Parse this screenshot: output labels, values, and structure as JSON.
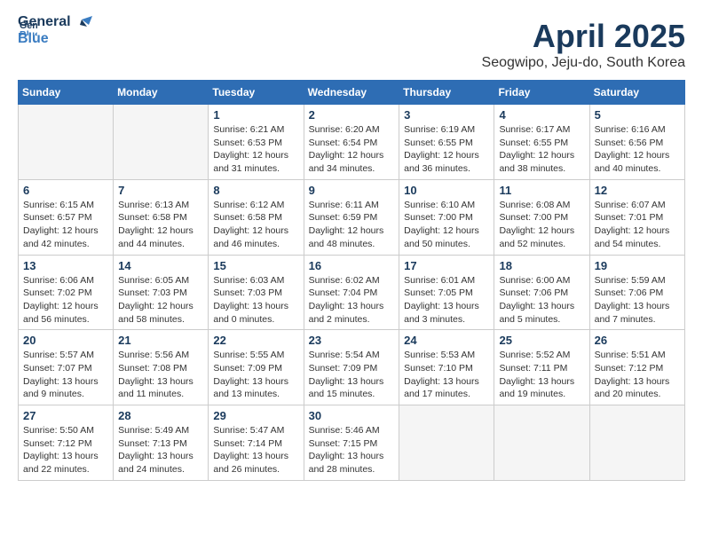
{
  "header": {
    "logo_line1": "General",
    "logo_line2": "Blue",
    "month": "April 2025",
    "location": "Seogwipo, Jeju-do, South Korea"
  },
  "weekdays": [
    "Sunday",
    "Monday",
    "Tuesday",
    "Wednesday",
    "Thursday",
    "Friday",
    "Saturday"
  ],
  "weeks": [
    [
      {
        "day": "",
        "info": ""
      },
      {
        "day": "",
        "info": ""
      },
      {
        "day": "1",
        "info": "Sunrise: 6:21 AM\nSunset: 6:53 PM\nDaylight: 12 hours\nand 31 minutes."
      },
      {
        "day": "2",
        "info": "Sunrise: 6:20 AM\nSunset: 6:54 PM\nDaylight: 12 hours\nand 34 minutes."
      },
      {
        "day": "3",
        "info": "Sunrise: 6:19 AM\nSunset: 6:55 PM\nDaylight: 12 hours\nand 36 minutes."
      },
      {
        "day": "4",
        "info": "Sunrise: 6:17 AM\nSunset: 6:55 PM\nDaylight: 12 hours\nand 38 minutes."
      },
      {
        "day": "5",
        "info": "Sunrise: 6:16 AM\nSunset: 6:56 PM\nDaylight: 12 hours\nand 40 minutes."
      }
    ],
    [
      {
        "day": "6",
        "info": "Sunrise: 6:15 AM\nSunset: 6:57 PM\nDaylight: 12 hours\nand 42 minutes."
      },
      {
        "day": "7",
        "info": "Sunrise: 6:13 AM\nSunset: 6:58 PM\nDaylight: 12 hours\nand 44 minutes."
      },
      {
        "day": "8",
        "info": "Sunrise: 6:12 AM\nSunset: 6:58 PM\nDaylight: 12 hours\nand 46 minutes."
      },
      {
        "day": "9",
        "info": "Sunrise: 6:11 AM\nSunset: 6:59 PM\nDaylight: 12 hours\nand 48 minutes."
      },
      {
        "day": "10",
        "info": "Sunrise: 6:10 AM\nSunset: 7:00 PM\nDaylight: 12 hours\nand 50 minutes."
      },
      {
        "day": "11",
        "info": "Sunrise: 6:08 AM\nSunset: 7:00 PM\nDaylight: 12 hours\nand 52 minutes."
      },
      {
        "day": "12",
        "info": "Sunrise: 6:07 AM\nSunset: 7:01 PM\nDaylight: 12 hours\nand 54 minutes."
      }
    ],
    [
      {
        "day": "13",
        "info": "Sunrise: 6:06 AM\nSunset: 7:02 PM\nDaylight: 12 hours\nand 56 minutes."
      },
      {
        "day": "14",
        "info": "Sunrise: 6:05 AM\nSunset: 7:03 PM\nDaylight: 12 hours\nand 58 minutes."
      },
      {
        "day": "15",
        "info": "Sunrise: 6:03 AM\nSunset: 7:03 PM\nDaylight: 13 hours\nand 0 minutes."
      },
      {
        "day": "16",
        "info": "Sunrise: 6:02 AM\nSunset: 7:04 PM\nDaylight: 13 hours\nand 2 minutes."
      },
      {
        "day": "17",
        "info": "Sunrise: 6:01 AM\nSunset: 7:05 PM\nDaylight: 13 hours\nand 3 minutes."
      },
      {
        "day": "18",
        "info": "Sunrise: 6:00 AM\nSunset: 7:06 PM\nDaylight: 13 hours\nand 5 minutes."
      },
      {
        "day": "19",
        "info": "Sunrise: 5:59 AM\nSunset: 7:06 PM\nDaylight: 13 hours\nand 7 minutes."
      }
    ],
    [
      {
        "day": "20",
        "info": "Sunrise: 5:57 AM\nSunset: 7:07 PM\nDaylight: 13 hours\nand 9 minutes."
      },
      {
        "day": "21",
        "info": "Sunrise: 5:56 AM\nSunset: 7:08 PM\nDaylight: 13 hours\nand 11 minutes."
      },
      {
        "day": "22",
        "info": "Sunrise: 5:55 AM\nSunset: 7:09 PM\nDaylight: 13 hours\nand 13 minutes."
      },
      {
        "day": "23",
        "info": "Sunrise: 5:54 AM\nSunset: 7:09 PM\nDaylight: 13 hours\nand 15 minutes."
      },
      {
        "day": "24",
        "info": "Sunrise: 5:53 AM\nSunset: 7:10 PM\nDaylight: 13 hours\nand 17 minutes."
      },
      {
        "day": "25",
        "info": "Sunrise: 5:52 AM\nSunset: 7:11 PM\nDaylight: 13 hours\nand 19 minutes."
      },
      {
        "day": "26",
        "info": "Sunrise: 5:51 AM\nSunset: 7:12 PM\nDaylight: 13 hours\nand 20 minutes."
      }
    ],
    [
      {
        "day": "27",
        "info": "Sunrise: 5:50 AM\nSunset: 7:12 PM\nDaylight: 13 hours\nand 22 minutes."
      },
      {
        "day": "28",
        "info": "Sunrise: 5:49 AM\nSunset: 7:13 PM\nDaylight: 13 hours\nand 24 minutes."
      },
      {
        "day": "29",
        "info": "Sunrise: 5:47 AM\nSunset: 7:14 PM\nDaylight: 13 hours\nand 26 minutes."
      },
      {
        "day": "30",
        "info": "Sunrise: 5:46 AM\nSunset: 7:15 PM\nDaylight: 13 hours\nand 28 minutes."
      },
      {
        "day": "",
        "info": ""
      },
      {
        "day": "",
        "info": ""
      },
      {
        "day": "",
        "info": ""
      }
    ]
  ]
}
